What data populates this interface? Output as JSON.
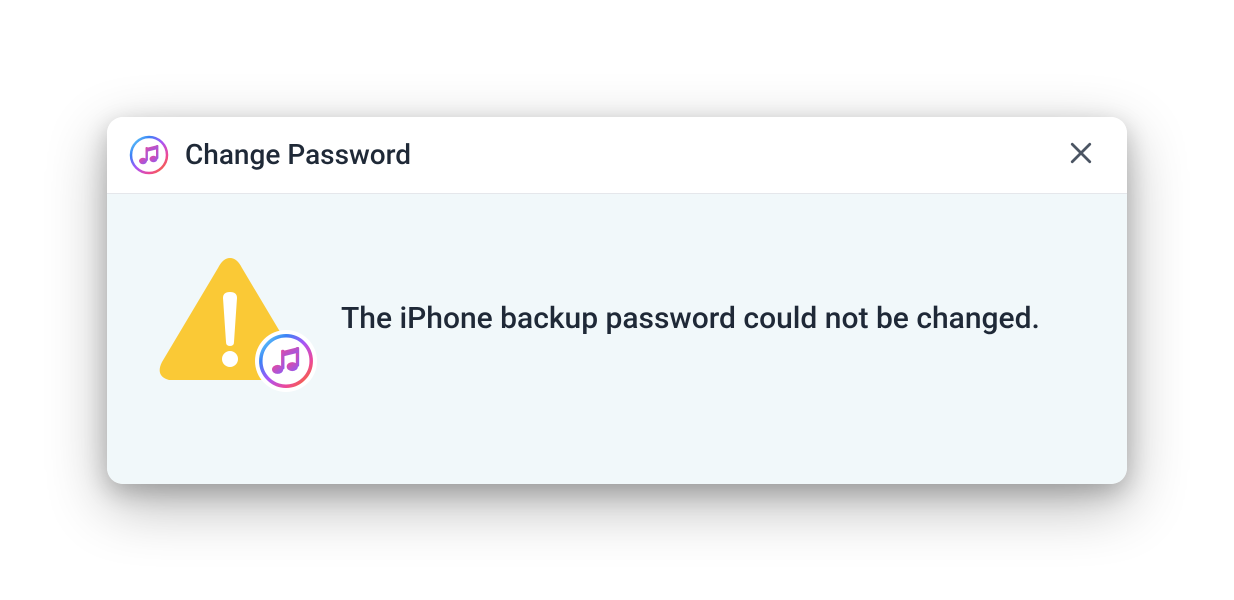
{
  "dialog": {
    "title": "Change Password",
    "message": "The iPhone backup password could not be changed.",
    "icons": {
      "titlebar_app": "itunes-icon",
      "close": "close-icon",
      "warning": "warning-triangle-icon",
      "warning_badge": "itunes-icon"
    },
    "colors": {
      "warning": "#fac936",
      "body_bg": "#f1f8fa",
      "text": "#1f2937"
    }
  }
}
